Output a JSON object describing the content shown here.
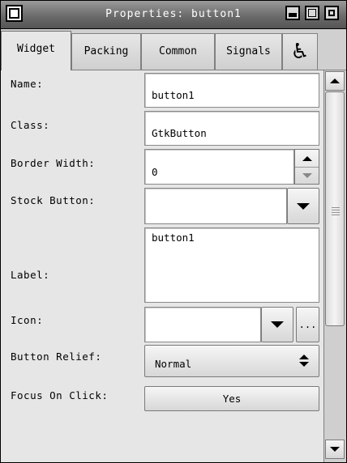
{
  "window": {
    "title": "Properties: button1"
  },
  "tabs": [
    {
      "label": "Widget",
      "active": true
    },
    {
      "label": "Packing",
      "active": false
    },
    {
      "label": "Common",
      "active": false
    },
    {
      "label": "Signals",
      "active": false
    },
    {
      "icon": "accessibility-icon",
      "glyph": "♿",
      "active": false
    }
  ],
  "fields": {
    "name": {
      "label": "Name:",
      "value": "button1"
    },
    "class": {
      "label": "Class:",
      "value": "GtkButton"
    },
    "border_width": {
      "label": "Border Width:",
      "value": "0"
    },
    "stock_button": {
      "label": "Stock Button:",
      "value": ""
    },
    "label": {
      "label": "Label:",
      "value": "button1"
    },
    "icon": {
      "label": "Icon:",
      "value": "",
      "browse_label": "..."
    },
    "button_relief": {
      "label": "Button Relief:",
      "value": "Normal"
    },
    "focus_on_click": {
      "label": "Focus On Click:",
      "value": "Yes"
    }
  },
  "colors": {
    "window_bg": "#e6e6e6",
    "titlebar": "#6b6b6b",
    "entry_bg": "#ffffff"
  }
}
